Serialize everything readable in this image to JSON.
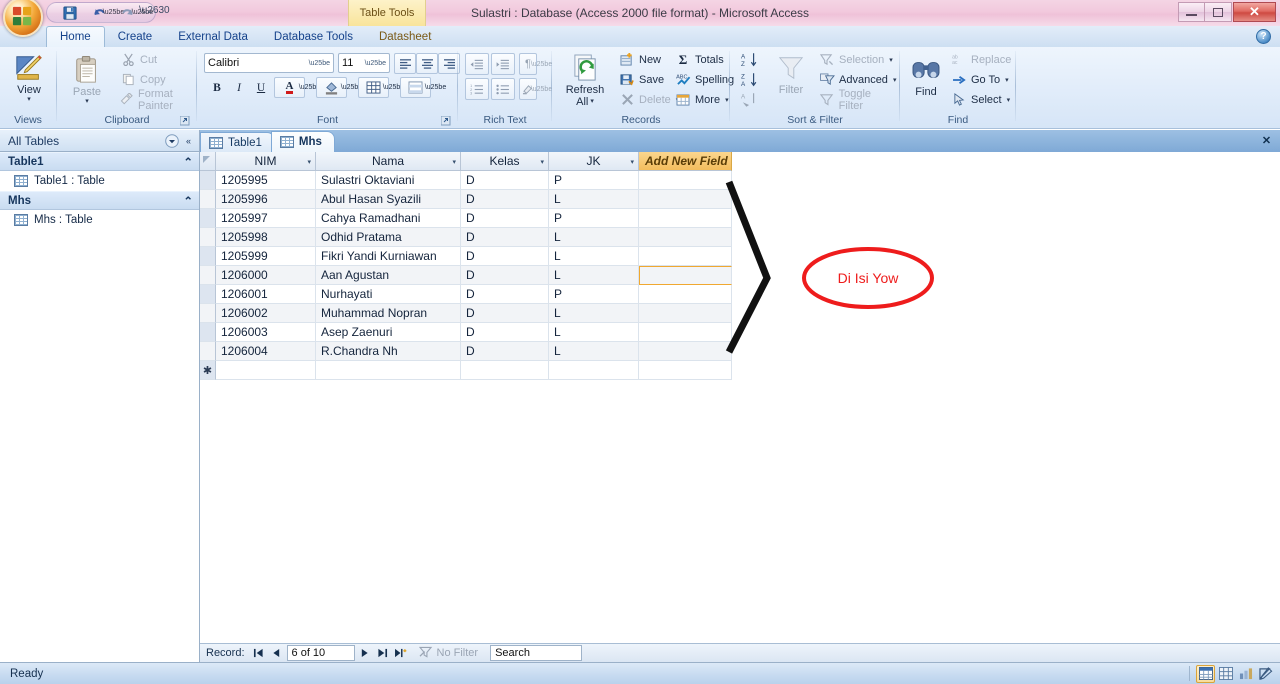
{
  "window": {
    "title": "Sulastri : Database (Access 2000 file format)  -  Microsoft Access",
    "contextual_tab_title": "Table Tools",
    "minimize_label": "–",
    "restore_label": "❐",
    "close_label": "✕",
    "help_label": "?"
  },
  "quick_access": {
    "save_icon": "save-icon",
    "undo_icon": "undo-icon",
    "redo_icon": "redo-icon",
    "customize_icon": "customize-qat-icon"
  },
  "ribbon": {
    "tabs": [
      {
        "label": "Home",
        "active": true
      },
      {
        "label": "Create",
        "active": false
      },
      {
        "label": "External Data",
        "active": false
      },
      {
        "label": "Database Tools",
        "active": false
      },
      {
        "label": "Datasheet",
        "active": false
      }
    ],
    "groups": {
      "views": {
        "label": "Views",
        "view_button": "View",
        "view_caret": "▾"
      },
      "clipboard": {
        "label": "Clipboard",
        "paste": "Paste",
        "paste_caret": "▾",
        "cut": "Cut",
        "copy": "Copy",
        "format_painter": "Format Painter"
      },
      "font": {
        "label": "Font",
        "font_name": "Calibri",
        "font_size": "11",
        "bold": "B",
        "italic": "I",
        "underline": "U",
        "font_color": "A",
        "fill_color": "fill-color-icon",
        "gridlines": "gridlines-icon",
        "alternate_fill": "alternate-fill-icon",
        "align_left": "align-left-icon",
        "align_center": "align-center-icon",
        "align_right": "align-right-icon"
      },
      "rich_text": {
        "label": "Rich Text",
        "decrease_indent": "decrease-indent-icon",
        "increase_indent": "increase-indent-icon",
        "ltr": "¶",
        "numbered_list": "numbered-list-icon",
        "bulleted_list": "bulleted-list-icon",
        "highlight": "highlight-icon"
      },
      "records": {
        "label": "Records",
        "refresh_all": "Refresh",
        "refresh_all_line2": "All",
        "refresh_caret": "▾",
        "new": "New",
        "save": "Save",
        "delete": "Delete",
        "delete_caret": "▾",
        "totals": "Totals",
        "totals_icon": "Σ",
        "spelling": "Spelling",
        "more": "More",
        "more_caret": "▾"
      },
      "sort_filter": {
        "label": "Sort & Filter",
        "sort_asc": "sort-ascending-icon",
        "sort_desc": "sort-descending-icon",
        "clear_sort": "clear-sort-icon",
        "filter": "Filter",
        "selection": "Selection",
        "selection_caret": "▾",
        "advanced": "Advanced",
        "advanced_caret": "▾",
        "toggle_filter": "Toggle Filter"
      },
      "find": {
        "label": "Find",
        "find": "Find",
        "replace": "Replace",
        "go_to": "Go To",
        "go_to_caret": "▾",
        "select": "Select",
        "select_caret": "▾"
      }
    }
  },
  "navigation_pane": {
    "header": "All Tables",
    "dropdown_icon": "chevron-down-icon",
    "collapse_icon": "«",
    "groups": [
      {
        "title": "Table1",
        "collapse_glyph": "⌃",
        "items": [
          {
            "label": "Table1 : Table",
            "icon": "table-icon"
          }
        ]
      },
      {
        "title": "Mhs",
        "collapse_glyph": "⌃",
        "items": [
          {
            "label": "Mhs : Table",
            "icon": "table-icon"
          }
        ]
      }
    ]
  },
  "document_tabs": {
    "tabs": [
      {
        "label": "Table1",
        "icon": "table-icon",
        "active": false
      },
      {
        "label": "Mhs",
        "icon": "table-icon",
        "active": true
      }
    ],
    "close_label": "✕"
  },
  "datasheet": {
    "columns": [
      {
        "label": "NIM",
        "width": 100,
        "align": "center",
        "dropdown": "▾"
      },
      {
        "label": "Nama",
        "width": 145,
        "align": "center",
        "dropdown": "▾"
      },
      {
        "label": "Kelas",
        "width": 88,
        "align": "center",
        "dropdown": "▾"
      },
      {
        "label": "JK",
        "width": 90,
        "align": "center",
        "dropdown": "▾"
      },
      {
        "label": "Add New Field",
        "width": 93,
        "align": "left",
        "dropdown": ""
      }
    ],
    "rows": [
      {
        "NIM": "1205995",
        "Nama": "Sulastri Oktaviani",
        "Kelas": "D",
        "JK": "P",
        "new": ""
      },
      {
        "NIM": "1205996",
        "Nama": "Abul Hasan Syazili",
        "Kelas": "D",
        "JK": "L",
        "new": ""
      },
      {
        "NIM": "1205997",
        "Nama": "Cahya Ramadhani",
        "Kelas": "D",
        "JK": "P",
        "new": ""
      },
      {
        "NIM": "1205998",
        "Nama": "Odhid Pratama",
        "Kelas": "D",
        "JK": "L",
        "new": ""
      },
      {
        "NIM": "1205999",
        "Nama": "Fikri Yandi Kurniawan",
        "Kelas": "D",
        "JK": "L",
        "new": ""
      },
      {
        "NIM": "1206000",
        "Nama": "Aan Agustan",
        "Kelas": "D",
        "JK": "L",
        "new": ""
      },
      {
        "NIM": "1206001",
        "Nama": "Nurhayati",
        "Kelas": "D",
        "JK": "P",
        "new": ""
      },
      {
        "NIM": "1206002",
        "Nama": "Muhammad Nopran",
        "Kelas": "D",
        "JK": "L",
        "new": ""
      },
      {
        "NIM": "1206003",
        "Nama": "Asep Zaenuri",
        "Kelas": "D",
        "JK": "L",
        "new": ""
      },
      {
        "NIM": "1206004",
        "Nama": "R.Chandra Nh",
        "Kelas": "D",
        "JK": "L",
        "new": ""
      }
    ],
    "new_row_marker": "✱",
    "selected_row_index": 5,
    "selected_column": "Add New Field"
  },
  "annotation": {
    "text": "Di Isi Yow",
    "ellipse_color": "#ee1c1c",
    "arrow_color": "#111111",
    "arrow_shape": "chevron-pointing-left"
  },
  "record_nav": {
    "label": "Record:",
    "first": "⏮",
    "prev": "◂",
    "value": "6 of 10",
    "next": "▸",
    "last": "⏭",
    "new_record": "▸✱",
    "filter_status": "No Filter",
    "filter_icon": "filter-off-icon",
    "search_value": "Search"
  },
  "status_bar": {
    "text": "Ready",
    "views": [
      {
        "name": "datasheet-view",
        "glyph": "▤",
        "active": true
      },
      {
        "name": "pivottable-view",
        "glyph": "⊞",
        "active": false
      },
      {
        "name": "pivotchart-view",
        "glyph": "◧",
        "active": false
      },
      {
        "name": "design-view",
        "glyph": "✐",
        "active": false
      }
    ]
  }
}
